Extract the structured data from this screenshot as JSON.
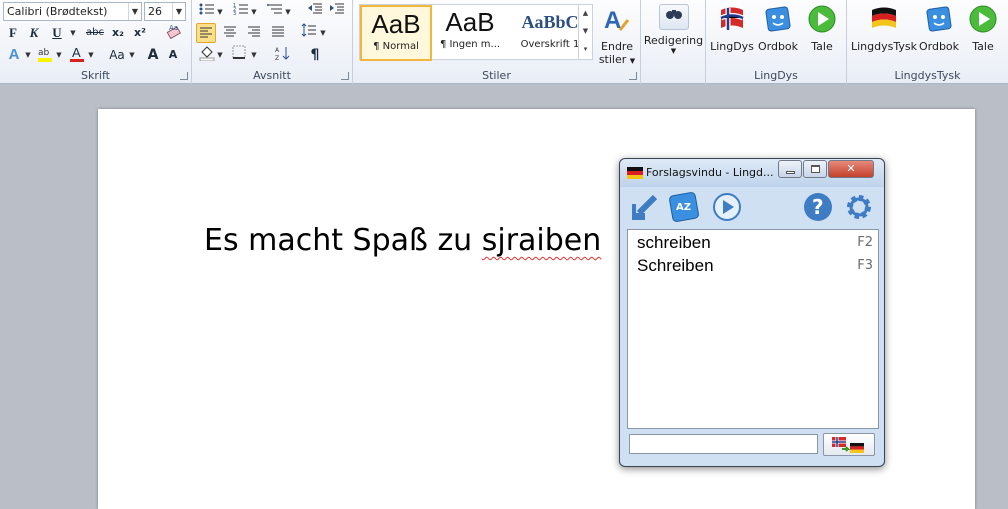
{
  "ribbon": {
    "font_group": {
      "label": "Skrift",
      "font_name": "Calibri (Brødtekst)",
      "font_size": "26",
      "bold": "F",
      "italic": "K",
      "underline": "U",
      "strike": "abc",
      "subscript": "x₂",
      "superscript": "x²",
      "grow": "A",
      "shrink": "A",
      "case": "Aa",
      "color_letter": "A"
    },
    "paragraph_group": {
      "label": "Avsnitt"
    },
    "styles_group": {
      "label": "Stiler",
      "tiles": [
        {
          "preview": "AaB",
          "name": "¶ Normal"
        },
        {
          "preview": "AaB",
          "name": "¶ Ingen m..."
        },
        {
          "preview": "AaBbC",
          "name": "Overskrift 1"
        }
      ],
      "change_styles": [
        "Endre",
        "stiler"
      ]
    },
    "editing_group": {
      "label": "Redigering"
    },
    "lingdys_group": {
      "label": "LingDys",
      "buttons": [
        "LingDys",
        "Ordbok",
        "Tale"
      ]
    },
    "lingdystysk_group": {
      "label": "LingdysTysk",
      "buttons": [
        "LingdysTysk",
        "Ordbok",
        "Tale"
      ]
    }
  },
  "document": {
    "text_before": "Es macht Spaß zu ",
    "misspelled": "sjraiben"
  },
  "suggestion_window": {
    "title": "Forslagsvindu - Lingd...",
    "suggestions": [
      {
        "word": "schreiben",
        "key": "F2"
      },
      {
        "word": "Schreiben",
        "key": "F3"
      }
    ],
    "input_value": ""
  },
  "colors": {
    "accent": "#f1b63b",
    "squiggle": "#e0312f",
    "ribbon_bg": "#e9eef6",
    "canvas_bg": "#babfc7"
  }
}
